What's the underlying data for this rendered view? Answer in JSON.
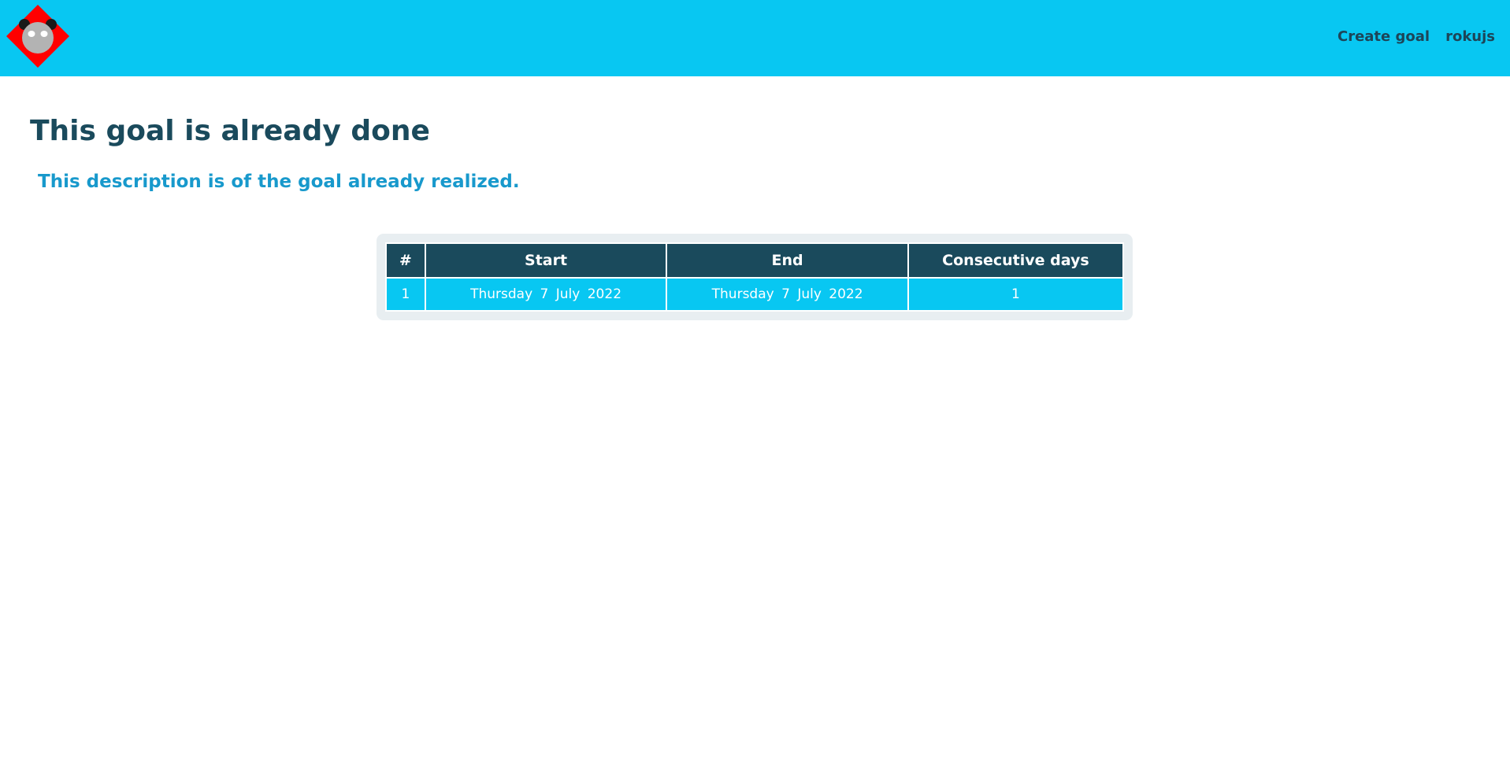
{
  "header": {
    "logo_icon": "panda-diamond-logo-icon",
    "nav": {
      "create_goal": "Create goal",
      "username": "rokujs"
    },
    "background": "#08c7f2"
  },
  "goal": {
    "title": "This goal is already done",
    "description": "This description is of the goal already realized."
  },
  "runs_table": {
    "columns": [
      "#",
      "Start",
      "End",
      "Consecutive days"
    ],
    "rows": [
      [
        "1",
        "Thursday 7 July 2022",
        "Thursday 7 July 2022",
        "1"
      ]
    ]
  },
  "colors": {
    "accent": "#08c7f2",
    "dark": "#1a4a5c",
    "description": "#1899cc",
    "logo_red": "#ff0000"
  }
}
